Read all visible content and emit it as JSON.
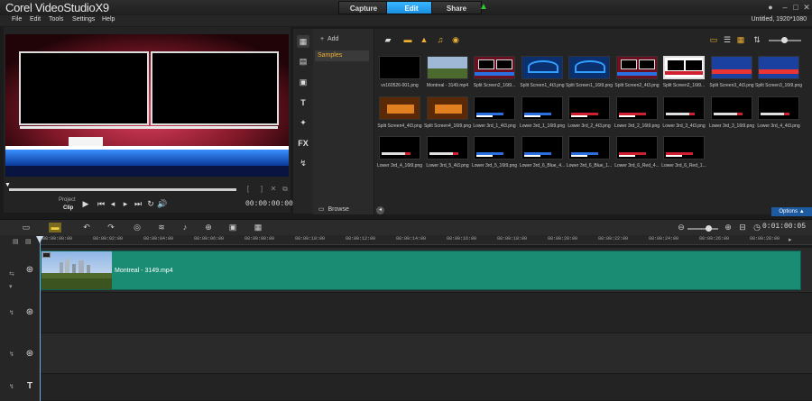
{
  "app": {
    "logo_main": "Corel VideoStudio",
    "logo_suffix": "X9",
    "project_info": "Untitled, 1920*1080"
  },
  "steps": {
    "capture": "Capture",
    "edit": "Edit",
    "share": "Share"
  },
  "menu": [
    "File",
    "Edit",
    "Tools",
    "Settings",
    "Help"
  ],
  "player": {
    "project_label": "Project",
    "clip_label": "Clip",
    "timecode": "00:00:00:00"
  },
  "library": {
    "add_label": "Add",
    "folder_selected": "Samples",
    "browse_label": "Browse",
    "options_label": "Options",
    "items": [
      "vx160526-001.png",
      "Montreal - 3149.mp4",
      "Split Screen2_16t9...",
      "Split Screen1_4t3.png",
      "Split Screen1_16t9.png",
      "Split Screen2_4t3.png",
      "Split Screen2_16t9...",
      "Split Screen3_4t3.png",
      "Split Screen3_16t9.png",
      "Split Screen4_4t3.png",
      "Split Screen4_16t9.png",
      "Lower 3rd_1_4t3.png",
      "Lower 3rd_1_16t9.png",
      "Lower 3rd_2_4t3.png",
      "Lower 3rd_2_16t9.png",
      "Lower 3rd_3_4t3.png",
      "Lower 3rd_3_16t9.png",
      "Lower 3rd_4_4t3.png",
      "Lower 3rd_4_16t9.png",
      "Lower 3rd_5_4t3.png",
      "Lower 3rd_5_16t9.png",
      "Lower 3rd_6_Blue_4...",
      "Lower 3rd_6_Blue_1...",
      "Lower 3rd_6_Red_4...",
      "Lower 3rd_6_Red_1..."
    ]
  },
  "timeline": {
    "time_readout": "0:01:00:05",
    "ruler": [
      "00:00:00:00",
      "00:00:02:00",
      "00:00:04:00",
      "00:00:06:00",
      "00:00:08:00",
      "00:00:10:00",
      "00:00:12:00",
      "00:00:14:00",
      "00:00:16:00",
      "00:00:18:00",
      "00:00:20:00",
      "00:00:22:00",
      "00:00:24:00",
      "00:00:26:00",
      "00:00:28:00"
    ],
    "clip_name": "Montreal - 3149.mp4"
  },
  "colors": {
    "accent": "#1a8fe0",
    "clip": "#1a8c74",
    "folder_highlight": "#f0b030"
  }
}
